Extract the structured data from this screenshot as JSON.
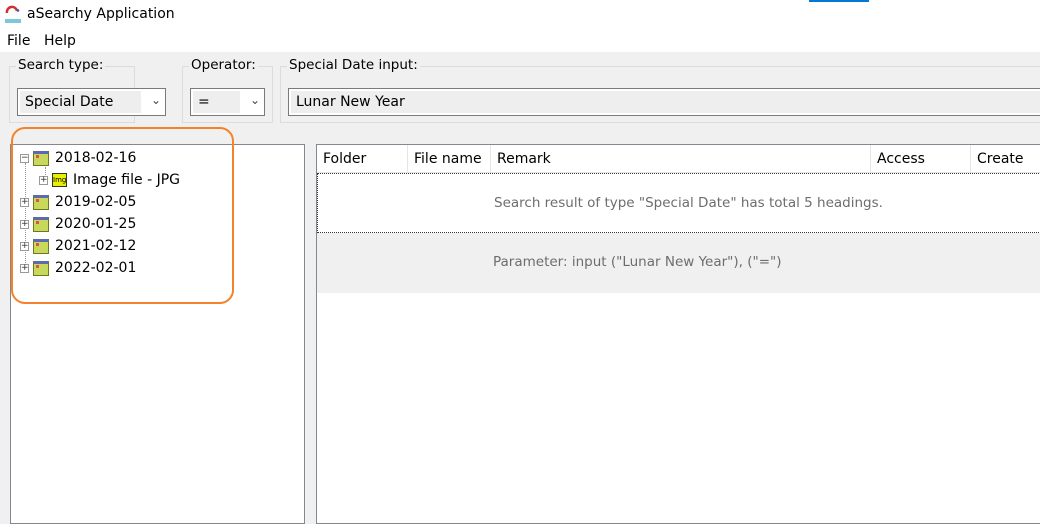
{
  "window": {
    "title": "aSearchy Application"
  },
  "menu": [
    "File",
    "Help"
  ],
  "search": {
    "type_label": "Search type:",
    "type_value": "Special Date",
    "operator_label": "Operator:",
    "operator_value": "=",
    "input_label": "Special Date input:",
    "input_value": "Lunar New Year"
  },
  "tree": {
    "nodes": [
      {
        "label": "2018-02-16",
        "expanded": true,
        "children": [
          {
            "label": "Image file - JPG",
            "icon": "jpg-folder-icon"
          }
        ]
      },
      {
        "label": "2019-02-05"
      },
      {
        "label": "2020-01-25"
      },
      {
        "label": "2021-02-12"
      },
      {
        "label": "2022-02-01"
      }
    ],
    "jpg_badge": "Img"
  },
  "list": {
    "columns": [
      "Folder",
      "File name",
      "Remark",
      "Access",
      "Create"
    ],
    "rows": [
      "Search result of type \"Special Date\" has total 5 headings.",
      "Parameter: input (\"Lunar New Year\"), (\"=\")"
    ]
  },
  "colors": {
    "highlight": "#f5822a",
    "accent": "#0078d7"
  }
}
